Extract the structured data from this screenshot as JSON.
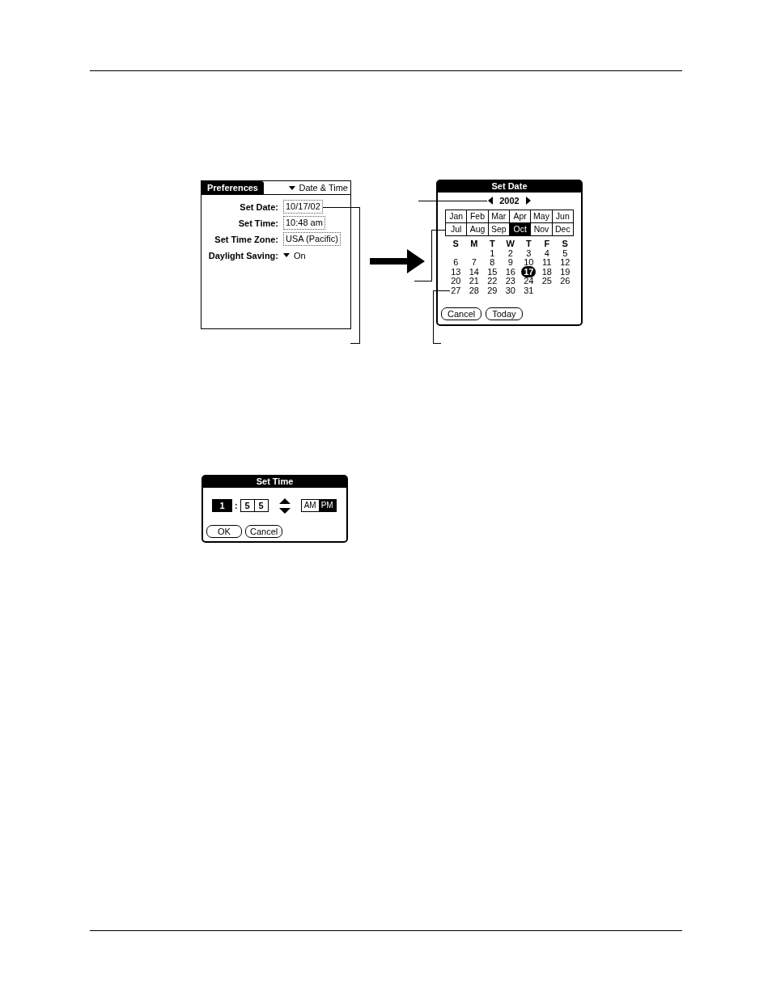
{
  "preferences": {
    "title": "Preferences",
    "category": "Date & Time",
    "fields": [
      {
        "label": "Set Date:",
        "value": "10/17/02",
        "kind": "selector"
      },
      {
        "label": "Set Time:",
        "value": "10:48 am",
        "kind": "selector"
      },
      {
        "label": "Set Time Zone:",
        "value": "USA (Pacific)",
        "kind": "selector"
      },
      {
        "label": "Daylight Saving:",
        "value": "On",
        "kind": "dropdown"
      }
    ]
  },
  "set_date": {
    "title": "Set Date",
    "year": "2002",
    "months": [
      {
        "label": "Jan",
        "selected": false
      },
      {
        "label": "Feb",
        "selected": false
      },
      {
        "label": "Mar",
        "selected": false
      },
      {
        "label": "Apr",
        "selected": false
      },
      {
        "label": "May",
        "selected": false
      },
      {
        "label": "Jun",
        "selected": false
      },
      {
        "label": "Jul",
        "selected": false
      },
      {
        "label": "Aug",
        "selected": false
      },
      {
        "label": "Sep",
        "selected": false
      },
      {
        "label": "Oct",
        "selected": true
      },
      {
        "label": "Nov",
        "selected": false
      },
      {
        "label": "Dec",
        "selected": false
      }
    ],
    "weekdays": [
      "S",
      "M",
      "T",
      "W",
      "T",
      "F",
      "S"
    ],
    "weeks": [
      [
        {
          "day": "1",
          "selected": false
        },
        {
          "day": "2",
          "selected": false
        },
        {
          "day": "3",
          "selected": false
        },
        {
          "day": "4",
          "selected": false
        },
        {
          "day": "5",
          "selected": false
        }
      ],
      [
        {
          "day": "6",
          "selected": false
        },
        {
          "day": "7",
          "selected": false
        },
        {
          "day": "8",
          "selected": false
        },
        {
          "day": "9",
          "selected": false
        },
        {
          "day": "10",
          "selected": false
        },
        {
          "day": "11",
          "selected": false
        },
        {
          "day": "12",
          "selected": false
        }
      ],
      [
        {
          "day": "13",
          "selected": false
        },
        {
          "day": "14",
          "selected": false
        },
        {
          "day": "15",
          "selected": false
        },
        {
          "day": "16",
          "selected": false
        },
        {
          "day": "17",
          "selected": true
        },
        {
          "day": "18",
          "selected": false
        },
        {
          "day": "19",
          "selected": false
        }
      ],
      [
        {
          "day": "20",
          "selected": false
        },
        {
          "day": "21",
          "selected": false
        },
        {
          "day": "22",
          "selected": false
        },
        {
          "day": "23",
          "selected": false
        },
        {
          "day": "24",
          "selected": false
        },
        {
          "day": "25",
          "selected": false
        },
        {
          "day": "26",
          "selected": false
        }
      ],
      [
        {
          "day": "27",
          "selected": false
        },
        {
          "day": "28",
          "selected": false
        },
        {
          "day": "29",
          "selected": false
        },
        {
          "day": "30",
          "selected": false
        },
        {
          "day": "31",
          "selected": false
        }
      ]
    ],
    "buttons": [
      "Cancel",
      "Today"
    ]
  },
  "set_time": {
    "title": "Set Time",
    "hour": {
      "value": "1",
      "selected": true
    },
    "separator": ":",
    "minutes": [
      {
        "value": "5",
        "selected": false
      },
      {
        "value": "5",
        "selected": false
      }
    ],
    "meridiem": [
      {
        "label": "AM",
        "selected": false
      },
      {
        "label": "PM",
        "selected": true
      }
    ],
    "buttons": [
      "OK",
      "Cancel"
    ]
  }
}
